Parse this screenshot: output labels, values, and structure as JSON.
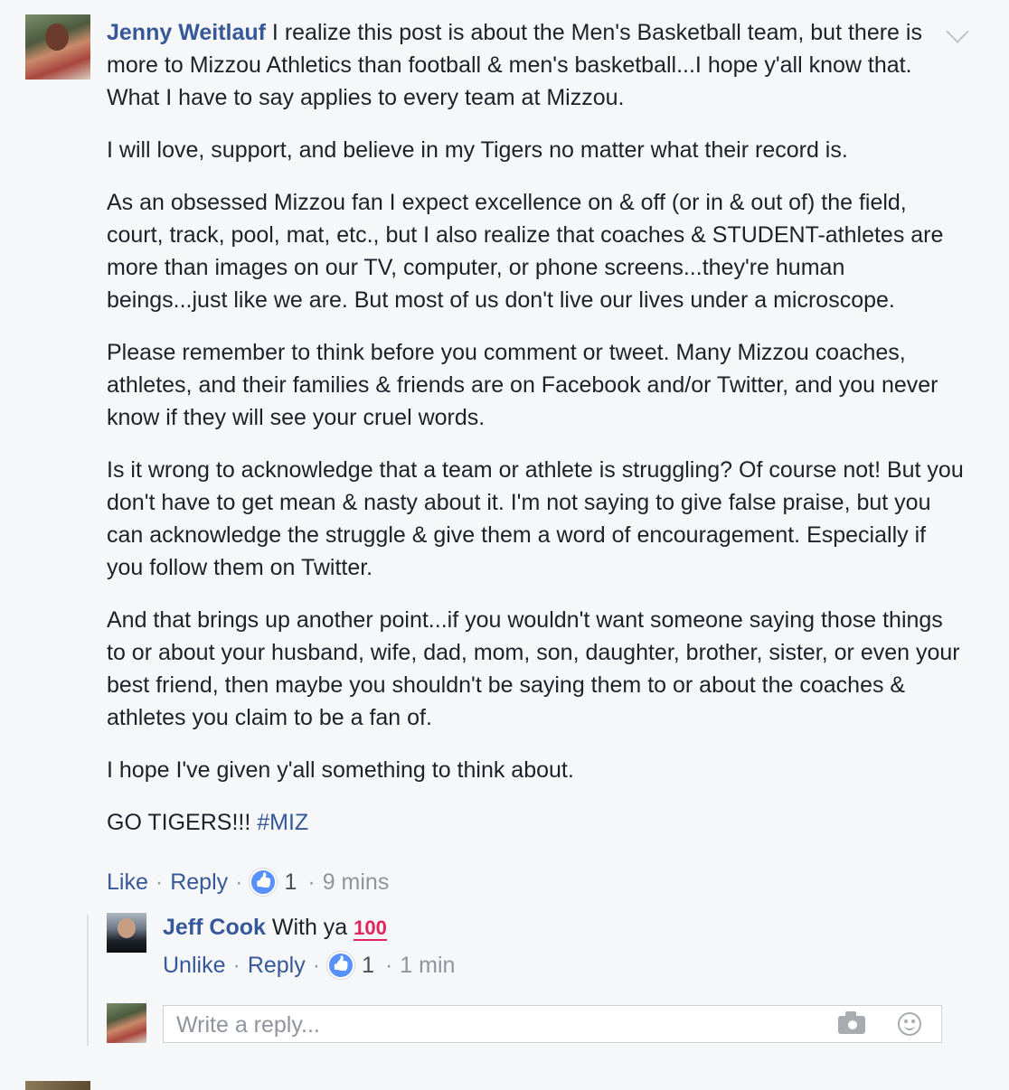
{
  "comment": {
    "author": "Jenny Weitlauf",
    "paragraphs": [
      "I realize this post is about the Men's Basketball team, but there is more to Mizzou Athletics than football & men's basketball...I hope y'all know that. What I have to say applies to every team at Mizzou.",
      "I will love, support, and believe in my Tigers no matter what their record is.",
      "As an obsessed Mizzou fan I expect excellence on & off (or in & out of) the field, court, track, pool, mat, etc., but I also realize that coaches & STUDENT-athletes are more than images on our TV, computer, or phone screens...they're human beings...just like we are. But most of us don't live our lives under a microscope.",
      "Please remember to think before you comment or tweet. Many Mizzou coaches, athletes, and their families & friends are on Facebook and/or Twitter, and you never know if they will see your cruel words.",
      "Is it wrong to acknowledge that a team or athlete is struggling? Of course not! But you don't have to get mean & nasty about it. I'm not saying to give false praise, but you can acknowledge the struggle & give them a word of encouragement. Especially if you follow them on Twitter.",
      "And that brings up another point...if you wouldn't want someone saying those things to or about your husband, wife, dad, mom, son, daughter, brother, sister, or even your best friend, then maybe you shouldn't be saying them to or about the coaches & athletes you claim to be a fan of.",
      "I hope I've given y'all something to think about."
    ],
    "closing": "GO TIGERS!!!",
    "hashtag": "#MIZ",
    "actions": {
      "like": "Like",
      "reply": "Reply",
      "like_count": "1",
      "time": "9 mins"
    }
  },
  "reply": {
    "author": "Jeff Cook",
    "text": "With ya",
    "emoji": "100",
    "actions": {
      "unlike": "Unlike",
      "reply": "Reply",
      "like_count": "1",
      "time": "1 min"
    }
  },
  "reply_box": {
    "placeholder": "Write a reply..."
  },
  "icons": {
    "like_badge": "thumbs-up-icon",
    "camera": "camera-icon",
    "emoji": "smiley-icon",
    "options": "chevron-down-icon"
  },
  "colors": {
    "link": "#365899",
    "meta": "#90949c",
    "like_badge": "#5890ff",
    "hundred_emoji": "#e0245e"
  }
}
